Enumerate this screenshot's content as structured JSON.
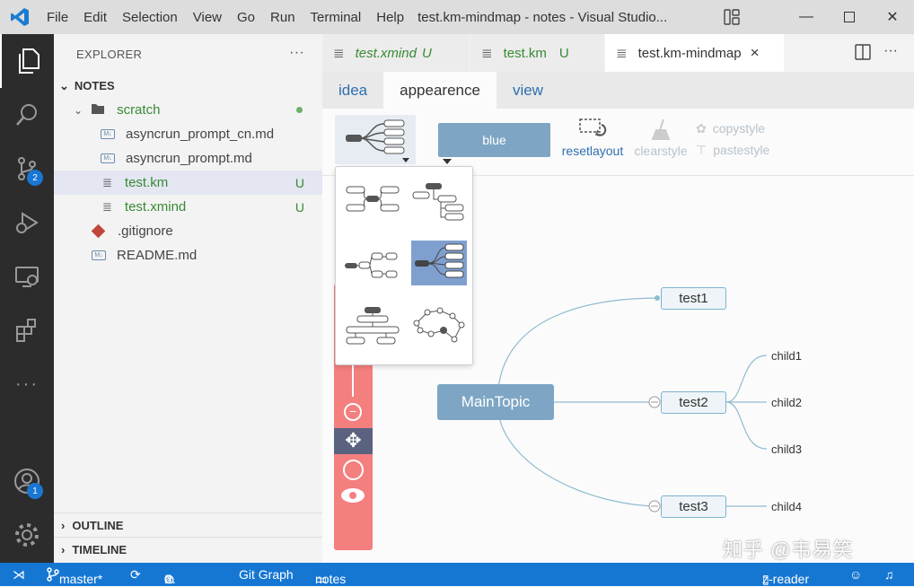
{
  "titlebar": {
    "menu": [
      "File",
      "Edit",
      "Selection",
      "View",
      "Go",
      "Run",
      "Terminal",
      "Help"
    ],
    "title": "test.km-mindmap - notes - Visual Studio..."
  },
  "activity": {
    "scm_badge": "2",
    "account_badge": "1"
  },
  "sidebar": {
    "header": "EXPLORER",
    "section": "NOTES",
    "folder": "scratch",
    "files": [
      {
        "name": "asyncrun_prompt_cn.md"
      },
      {
        "name": "asyncrun_prompt.md"
      },
      {
        "name": "test.km",
        "status": "U"
      },
      {
        "name": "test.xmind",
        "status": "U"
      }
    ],
    "root_files": [
      ".gitignore",
      "README.md"
    ],
    "outline": "OUTLINE",
    "timeline": "TIMELINE"
  },
  "tabs": [
    {
      "label": "test.xmind",
      "status": "U"
    },
    {
      "label": "test.km",
      "status": "U"
    },
    {
      "label": "test.km-mindmap",
      "close": "×"
    }
  ],
  "km_tabs": [
    "idea",
    "appearence",
    "view"
  ],
  "toolbar": {
    "theme": "blue",
    "resetlayout": "resetlayout",
    "clearstyle": "clearstyle",
    "copystyle": "copystyle",
    "pastestyle": "pastestyle"
  },
  "mindmap": {
    "main": "MainTopic",
    "topics": [
      "test1",
      "test2",
      "test3"
    ],
    "children": [
      "child1",
      "child2",
      "child3",
      "child4"
    ]
  },
  "statusbar": {
    "branch": "master*",
    "errors": "0",
    "warnings": "0",
    "git_graph": "Git Graph",
    "folder": "notes",
    "reader": "z-reader"
  },
  "watermark": "知乎 @韦易笑",
  "colors": {
    "accent": "#1677d3",
    "node_main": "#7ea6c4",
    "sidebar_bg": "#f3f3f3",
    "activity_bg": "#2c2c2c",
    "zoom_bar": "#f47f7f"
  }
}
